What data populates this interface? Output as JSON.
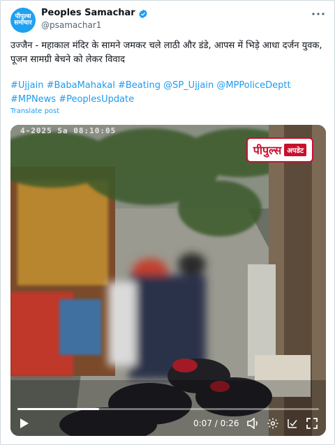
{
  "account": {
    "display_name": "Peoples Samachar",
    "handle": "@psamachar1",
    "avatar_text": "पीपुल्स समाचार"
  },
  "tweet": {
    "text": "उज्जैन - महाकाल मंदिर के सामने जमकर चले लाठी और डंडे, आपस में भिड़े आधा दर्जन युवक, पूजन सामग्री बेचने को लेकर विवाद",
    "hashtags": "#Ujjain #BabaMahakal #Beating @SP_Ujjain @MPPoliceDeptt #MPNews #PeoplesUpdate",
    "translate_label": "Translate post"
  },
  "video": {
    "overlay_timestamp": "4-2025 Sa 08:10:05",
    "watermark_main": "पीपुल्स",
    "watermark_badge": "अपडेट",
    "time_display": "0:07 / 0:26",
    "progress": 0.27
  },
  "colors": {
    "link": "#1d9bf0",
    "verified": "#1d9bf0",
    "watermark_red": "#c8102e"
  },
  "icons": [
    "verified-icon",
    "more-icon",
    "play-icon",
    "volume-icon",
    "settings-icon",
    "captions-icon",
    "fullscreen-icon"
  ]
}
